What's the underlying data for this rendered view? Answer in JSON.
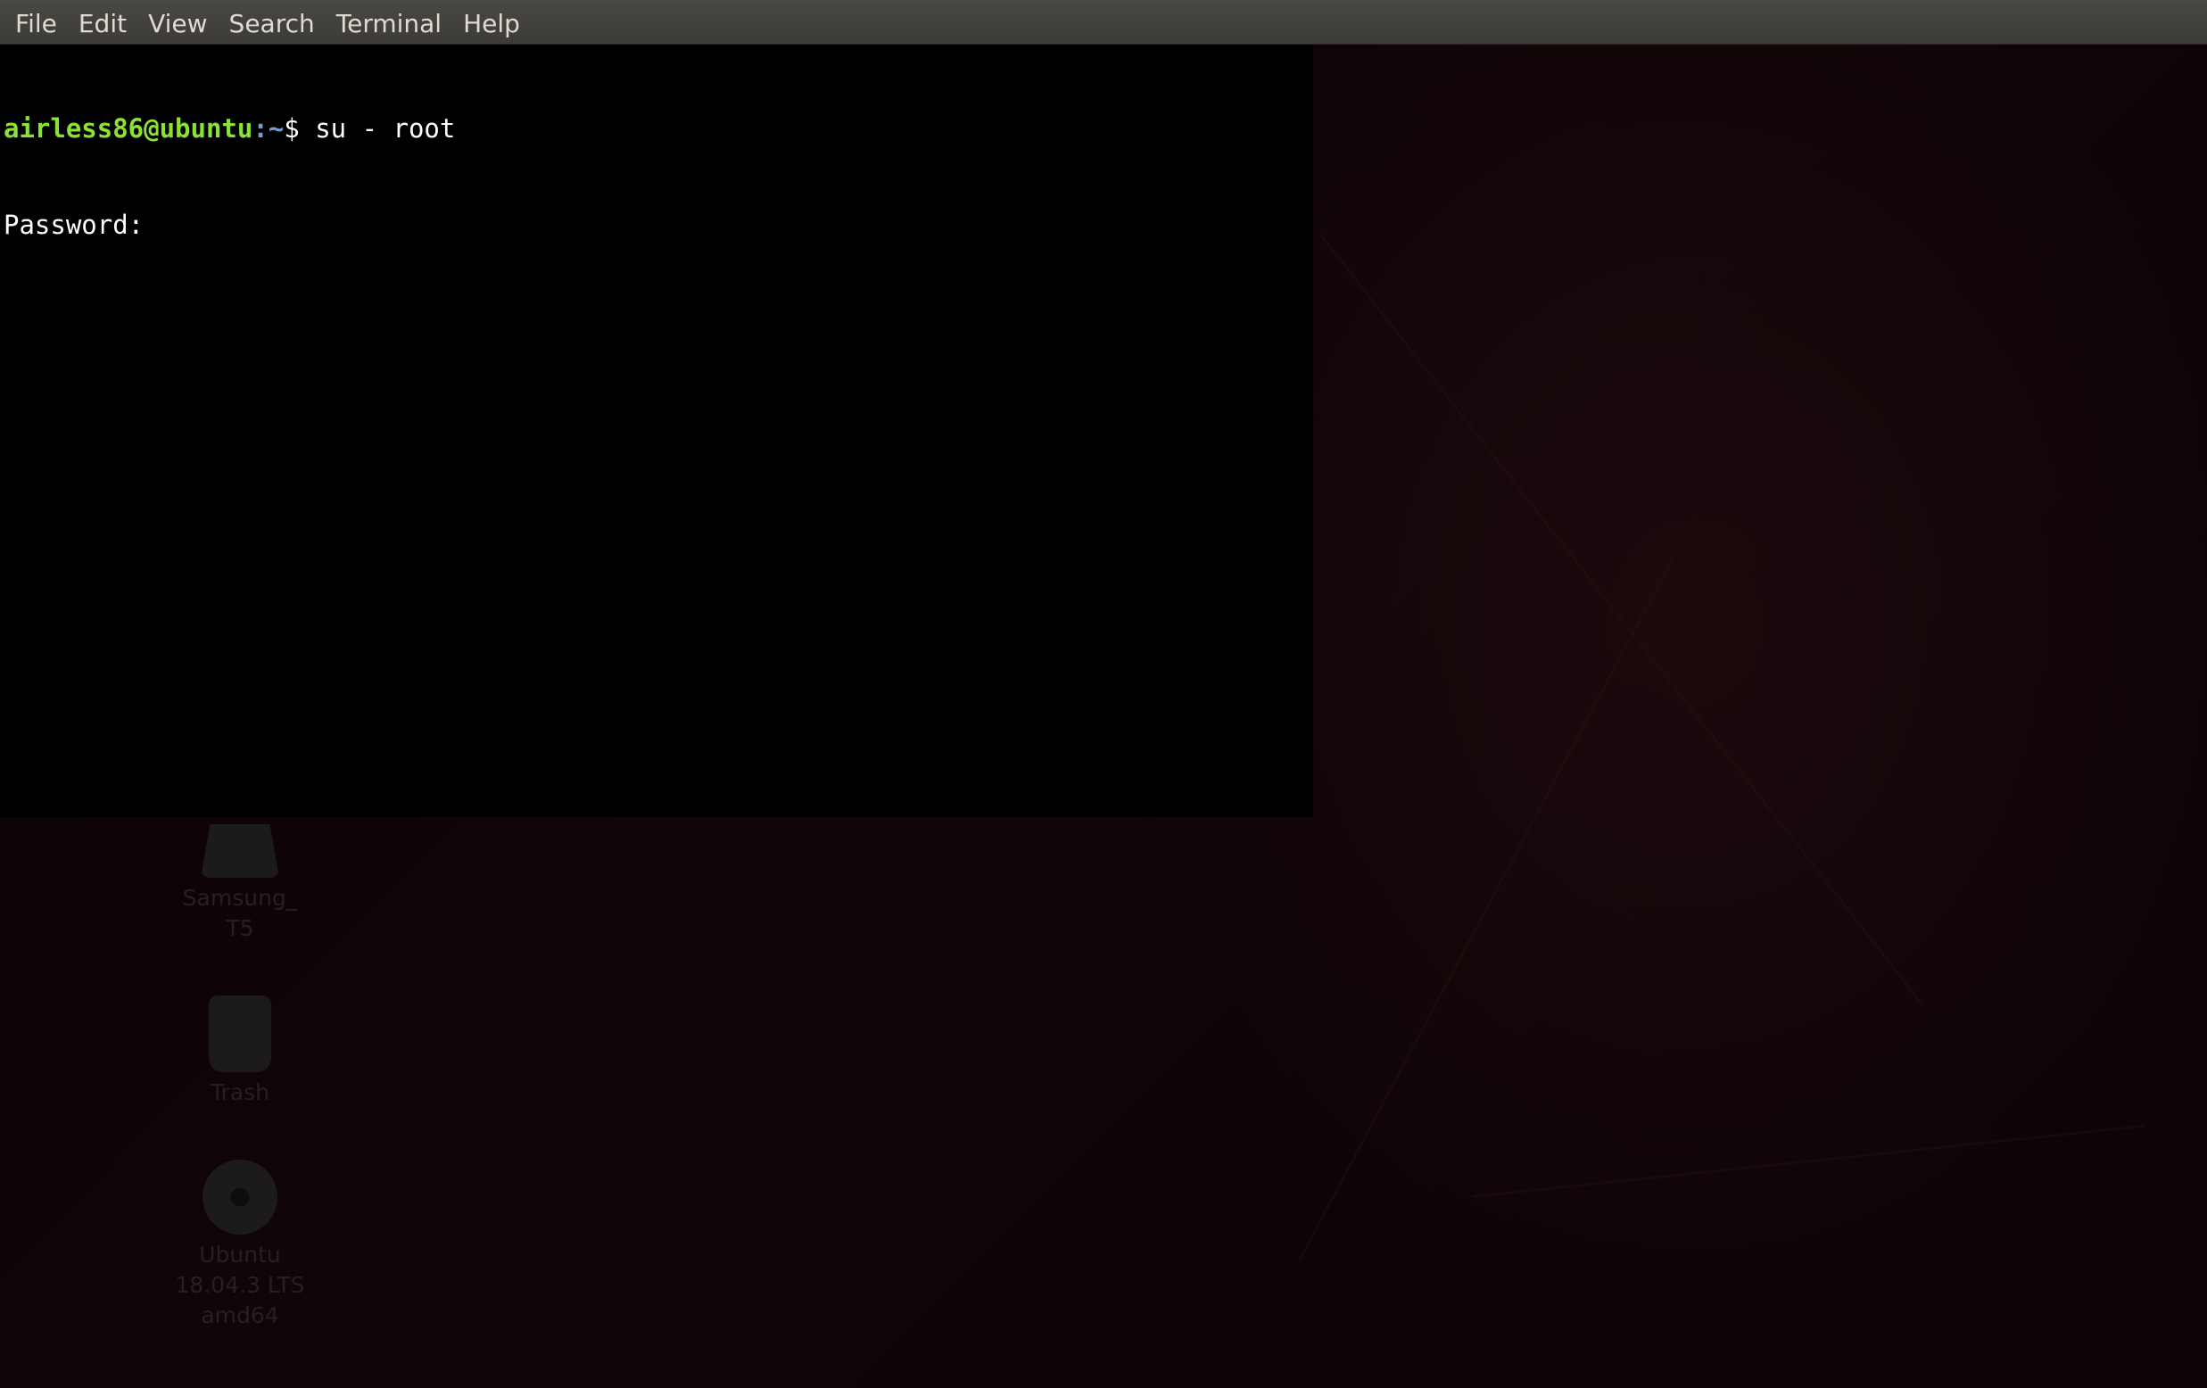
{
  "menubar": {
    "items": [
      "File",
      "Edit",
      "View",
      "Search",
      "Terminal",
      "Help"
    ]
  },
  "terminal": {
    "prompt_user": "airless86@ubuntu",
    "prompt_path": ":~",
    "prompt_symbol": "$ ",
    "command": "su - root",
    "output_line": "Password: "
  },
  "desktop": {
    "icons": [
      {
        "label_lines": [
          "Samsung_",
          "T5"
        ],
        "icon": "drive-icon"
      },
      {
        "label_lines": [
          "Trash"
        ],
        "icon": "trash-icon"
      },
      {
        "label_lines": [
          "Ubuntu",
          "18.04.3 LTS",
          "amd64"
        ],
        "icon": "disc-icon"
      }
    ]
  },
  "colors": {
    "menubar_bg": "#3c3b37",
    "menubar_text": "#dfdbd2",
    "terminal_bg": "#000000",
    "prompt_user": "#8ae234",
    "prompt_path": "#729fcf"
  }
}
